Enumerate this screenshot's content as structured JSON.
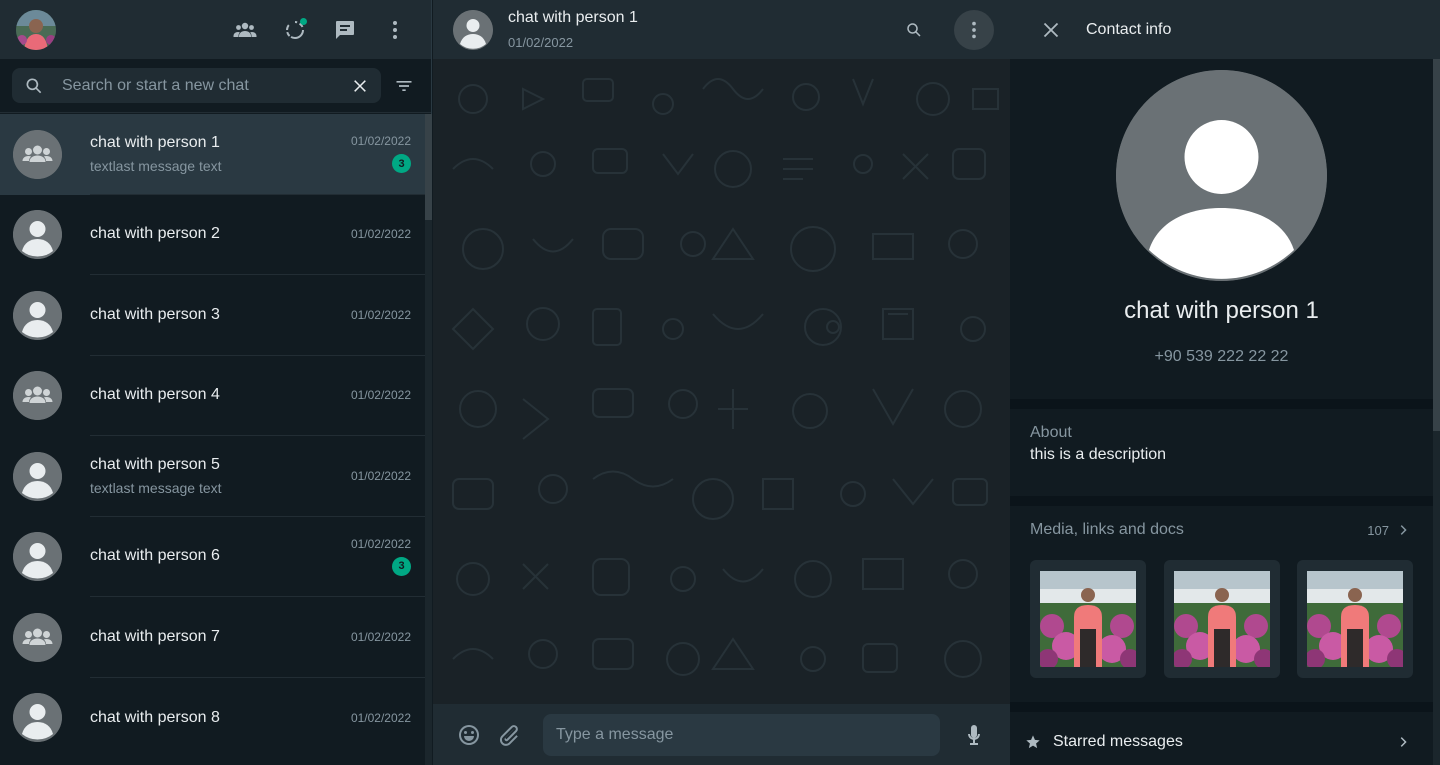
{
  "sidebar": {
    "search": {
      "placeholder": "Search or start a new chat"
    },
    "chats": [
      {
        "name": "chat with person 1",
        "last": "textlast message text",
        "time": "01/02/2022",
        "unread": "3",
        "kind": "group"
      },
      {
        "name": "chat with person 2",
        "last": "",
        "time": "01/02/2022",
        "unread": "",
        "kind": "person"
      },
      {
        "name": "chat with person 3",
        "last": "",
        "time": "01/02/2022",
        "unread": "",
        "kind": "person"
      },
      {
        "name": "chat with person 4",
        "last": "",
        "time": "01/02/2022",
        "unread": "",
        "kind": "group"
      },
      {
        "name": "chat with person 5",
        "last": "textlast message text",
        "time": "01/02/2022",
        "unread": "",
        "kind": "person"
      },
      {
        "name": "chat with person 6",
        "last": "",
        "time": "01/02/2022",
        "unread": "3",
        "kind": "person"
      },
      {
        "name": "chat with person 7",
        "last": "",
        "time": "01/02/2022",
        "unread": "",
        "kind": "group"
      },
      {
        "name": "chat with person 8",
        "last": "",
        "time": "01/02/2022",
        "unread": "",
        "kind": "person"
      }
    ]
  },
  "conversation": {
    "name": "chat with person 1",
    "subtitle": "01/02/2022",
    "composer_placeholder": "Type a message"
  },
  "contact_info": {
    "title": "Contact info",
    "name": "chat with person 1",
    "phone": "+90 539 222 22 22",
    "about_label": "About",
    "about_text": "this is a description",
    "media_label": "Media, links and docs",
    "media_count": "107",
    "starred_label": "Starred messages"
  },
  "colors": {
    "accent": "#00a884",
    "panel": "#202c33",
    "background": "#111b21"
  }
}
